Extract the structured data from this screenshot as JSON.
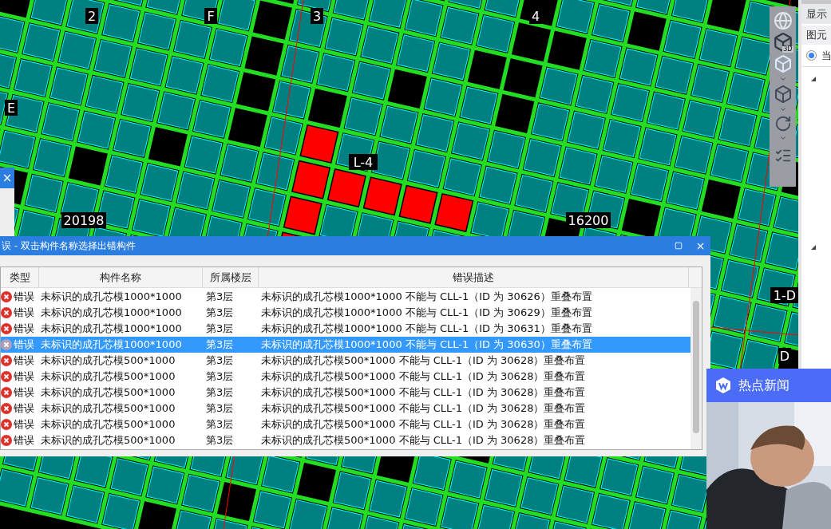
{
  "drawing": {
    "axis_labels": [
      {
        "text": "2"
      },
      {
        "text": "F"
      },
      {
        "text": "3"
      },
      {
        "text": "4"
      },
      {
        "text": "E"
      },
      {
        "text": "L-4"
      },
      {
        "text": "20198"
      },
      {
        "text": "16200"
      },
      {
        "text": "1-D"
      },
      {
        "text": "D"
      }
    ]
  },
  "view_toolbar": {
    "label_3d": "3D"
  },
  "side_panel": {
    "header": "显示",
    "tab": "图元",
    "radio": {
      "label": "当",
      "selected": true
    }
  },
  "left_panel": {
    "close": "×"
  },
  "error_dialog": {
    "title": "误 - 双击构件名称选择出错构件",
    "columns": [
      "类型",
      "构件名称",
      "所属楼层",
      "错误描述"
    ],
    "rows": [
      {
        "type": "错误",
        "name": "未标识的成孔芯模1000*1000",
        "floor": "第3层",
        "description": "未标识的成孔芯模1000*1000 不能与 CLL-1（ID 为 30626）重叠布置",
        "selected": false
      },
      {
        "type": "错误",
        "name": "未标识的成孔芯模1000*1000",
        "floor": "第3层",
        "description": "未标识的成孔芯模1000*1000 不能与 CLL-1（ID 为 30629）重叠布置",
        "selected": false
      },
      {
        "type": "错误",
        "name": "未标识的成孔芯模1000*1000",
        "floor": "第3层",
        "description": "未标识的成孔芯模1000*1000 不能与 CLL-1（ID 为 30631）重叠布置",
        "selected": false
      },
      {
        "type": "错误",
        "name": "未标识的成孔芯模1000*1000",
        "floor": "第3层",
        "description": "未标识的成孔芯模1000*1000 不能与 CLL-1（ID 为 30630）重叠布置",
        "selected": true
      },
      {
        "type": "错误",
        "name": "未标识的成孔芯模500*1000",
        "floor": "第3层",
        "description": "未标识的成孔芯模500*1000 不能与 CLL-1（ID 为 30628）重叠布置",
        "selected": false
      },
      {
        "type": "错误",
        "name": "未标识的成孔芯模500*1000",
        "floor": "第3层",
        "description": "未标识的成孔芯模500*1000 不能与 CLL-1（ID 为 30628）重叠布置",
        "selected": false
      },
      {
        "type": "错误",
        "name": "未标识的成孔芯模500*1000",
        "floor": "第3层",
        "description": "未标识的成孔芯模500*1000 不能与 CLL-1（ID 为 30628）重叠布置",
        "selected": false
      },
      {
        "type": "错误",
        "name": "未标识的成孔芯模500*1000",
        "floor": "第3层",
        "description": "未标识的成孔芯模500*1000 不能与 CLL-1（ID 为 30628）重叠布置",
        "selected": false
      },
      {
        "type": "错误",
        "name": "未标识的成孔芯模500*1000",
        "floor": "第3层",
        "description": "未标识的成孔芯模500*1000 不能与 CLL-1（ID 为 30628）重叠布置",
        "selected": false
      },
      {
        "type": "错误",
        "name": "未标识的成孔芯模500*1000",
        "floor": "第3层",
        "description": "未标识的成孔芯模500*1000 不能与 CLL-1（ID 为 30628）重叠布置",
        "selected": false
      }
    ]
  },
  "news_popup": {
    "title": "热点新闻"
  }
}
